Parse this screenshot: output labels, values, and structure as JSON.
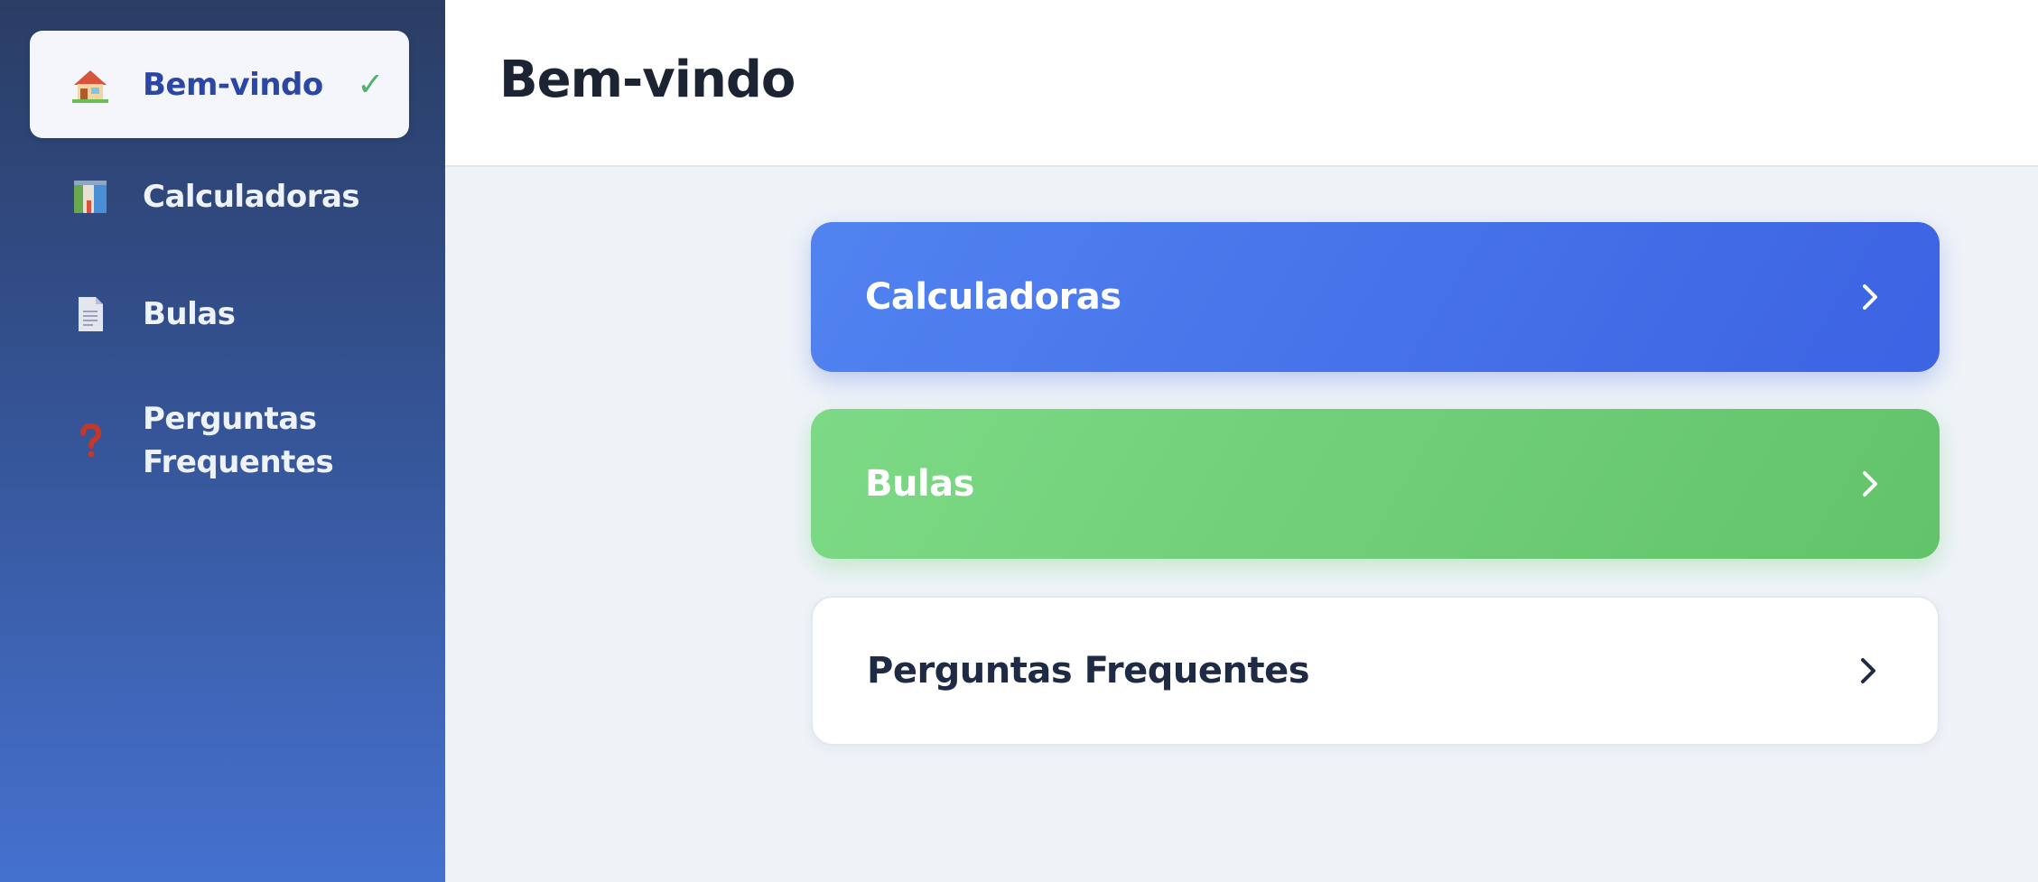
{
  "sidebar": {
    "items": [
      {
        "label": "Bem-vindo",
        "icon": "house-icon",
        "active": true,
        "status_icon": "✓"
      },
      {
        "label": "Calculadoras",
        "icon": "books-icon",
        "active": false
      },
      {
        "label": "Bulas",
        "icon": "document-icon",
        "active": false
      },
      {
        "label_line1": "Perguntas",
        "label_line2": "Frequentes",
        "icon": "question-icon",
        "active": false
      }
    ]
  },
  "header": {
    "title": "Bem-vindo"
  },
  "cards": [
    {
      "label": "Calculadoras",
      "color": "#4A76EC"
    },
    {
      "label": "Bulas",
      "color": "#6FCF77"
    },
    {
      "label": "Perguntas Frequentes",
      "color": "#FFFFFF"
    }
  ],
  "colors": {
    "sidebar_top": "#2A3D64",
    "sidebar_bottom": "#4571CF",
    "active_text": "#2C47A3",
    "check": "#4FB36A",
    "background": "#EFF3F8"
  }
}
